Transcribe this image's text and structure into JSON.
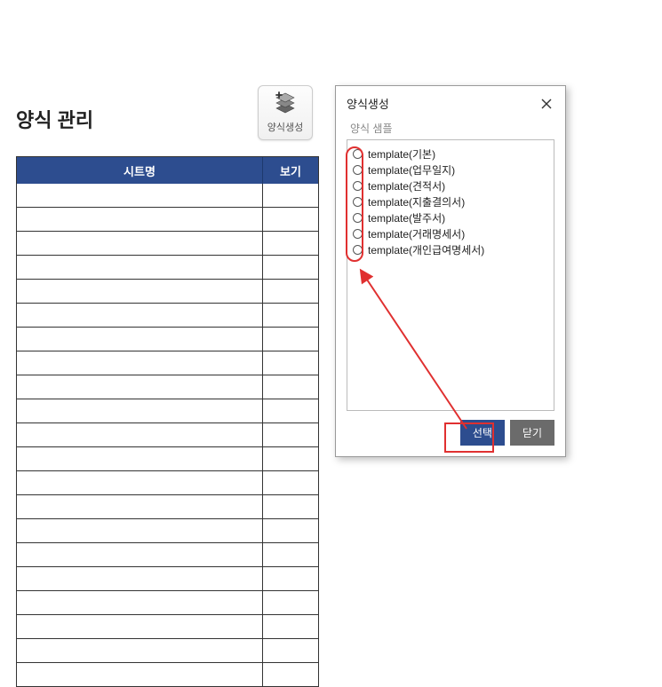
{
  "page": {
    "title": "양식 관리"
  },
  "toolbar": {
    "create_label": "양식생성"
  },
  "grid": {
    "headers": {
      "sheet": "시트명",
      "view": "보기"
    },
    "row_count": 21
  },
  "dialog": {
    "title": "양식생성",
    "subtitle": "양식 샘플",
    "templates": [
      "template(기본)",
      "template(업무일지)",
      "template(견적서)",
      "template(지출결의서)",
      "template(발주서)",
      "template(거래명세서)",
      "template(개인급여명세서)"
    ],
    "buttons": {
      "select": "선택",
      "close": "닫기"
    }
  },
  "annotations": {
    "highlight_color": "#e03030"
  }
}
